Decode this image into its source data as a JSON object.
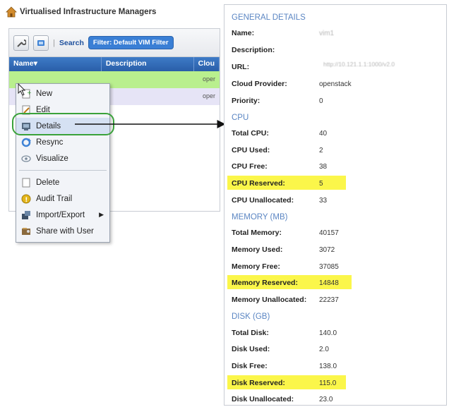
{
  "vim": {
    "title": "Virtualised Infrastructure Managers",
    "toolbar": {
      "search_label": "Search",
      "filter_label": "Filter: Default VIM Filter"
    },
    "columns": [
      "Name",
      "Description",
      "Clou"
    ],
    "rows": [
      {
        "cloud": "oper"
      },
      {
        "cloud": "oper"
      }
    ]
  },
  "context_menu": {
    "items": [
      {
        "label": "New",
        "icon": "new-icon"
      },
      {
        "label": "Edit",
        "icon": "edit-icon"
      },
      {
        "label": "Details",
        "icon": "details-icon"
      },
      {
        "label": "Resync",
        "icon": "resync-icon"
      },
      {
        "label": "Visualize",
        "icon": "visualize-icon"
      },
      {
        "label": "Delete",
        "icon": "delete-icon"
      },
      {
        "label": "Audit Trail",
        "icon": "audit-trail-icon"
      },
      {
        "label": "Import/Export",
        "icon": "import-export-icon"
      },
      {
        "label": "Share with User",
        "icon": "share-icon"
      }
    ]
  },
  "details": {
    "general": {
      "title": "GENERAL DETAILS",
      "fields": [
        {
          "label": "Name:",
          "value": "vim1"
        },
        {
          "label": "Description:",
          "value": ""
        },
        {
          "label": "URL:",
          "value": "http://10.121.1.1:1000/v2.0"
        },
        {
          "label": "Cloud Provider:",
          "value": "openstack"
        },
        {
          "label": "Priority:",
          "value": "0"
        }
      ]
    },
    "cpu": {
      "title": "CPU",
      "fields": [
        {
          "label": "Total CPU:",
          "value": "40"
        },
        {
          "label": "CPU Used:",
          "value": "2"
        },
        {
          "label": "CPU Free:",
          "value": "38"
        },
        {
          "label": "CPU Reserved:",
          "value": "5",
          "highlight": true
        },
        {
          "label": "CPU Unallocated:",
          "value": "33"
        }
      ]
    },
    "memory": {
      "title": "MEMORY (MB)",
      "fields": [
        {
          "label": "Total Memory:",
          "value": "40157"
        },
        {
          "label": "Memory Used:",
          "value": "3072"
        },
        {
          "label": "Memory Free:",
          "value": "37085"
        },
        {
          "label": "Memory Reserved:",
          "value": "14848",
          "highlight": true
        },
        {
          "label": "Memory Unallocated:",
          "value": "22237"
        }
      ]
    },
    "disk": {
      "title": "DISK (GB)",
      "fields": [
        {
          "label": "Total Disk:",
          "value": "140.0"
        },
        {
          "label": "Disk Used:",
          "value": "2.0"
        },
        {
          "label": "Disk Free:",
          "value": "138.0"
        },
        {
          "label": "Disk Reserved:",
          "value": "115.0",
          "highlight": true
        },
        {
          "label": "Disk Unallocated:",
          "value": "23.0"
        }
      ]
    }
  },
  "colors": {
    "highlight": "#fbf64a",
    "ring": "#3aa23a",
    "section_title": "#5b86c3",
    "grid_header": "#2a5ea8"
  }
}
